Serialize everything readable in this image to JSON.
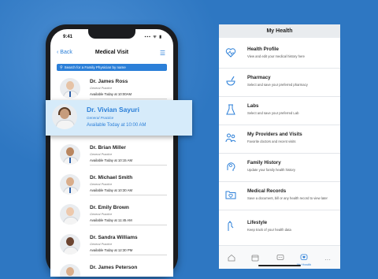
{
  "phone": {
    "status_time": "9:41",
    "status_icons": "▪▪▪ ᯤ ▮",
    "nav": {
      "back_label": "Back",
      "title": "Medical Visit"
    },
    "search_placeholder": "Search for a Family Physician by name",
    "doctors": [
      {
        "name": "Dr. James Ross",
        "specialty": "General Practice",
        "availability": "Available Today at 10:00AM",
        "skin": "#e6c3a6"
      },
      {
        "name": "Dr. Brian Miller",
        "specialty": "General Practice",
        "availability": "Available Today at 10:15 AM",
        "skin": "#b9865f"
      },
      {
        "name": "Dr. Michael Smith",
        "specialty": "General Practice",
        "availability": "Available Today at 10:30 AM",
        "skin": "#d9ad8a"
      },
      {
        "name": "Dr. Emily Brown",
        "specialty": "General Practice",
        "availability": "Available Today at 11:45 AM",
        "skin": "#edc9ad"
      },
      {
        "name": "Dr. Sandra Williams",
        "specialty": "General Practice",
        "availability": "Available Today at 12:30 PM",
        "skin": "#6b4430"
      },
      {
        "name": "Dr. James Peterson",
        "specialty": "",
        "availability": "",
        "skin": "#d9ad8a"
      }
    ],
    "highlighted": {
      "name": "Dr. Vivian Sayuri",
      "specialty": "General Practice",
      "availability": "Available Today at 10:00 AM"
    }
  },
  "panel": {
    "title": "My Health",
    "items": [
      {
        "title": "Health Profile",
        "desc": "View and edit your medical history here",
        "icon": "heart-pulse-icon"
      },
      {
        "title": "Pharmacy",
        "desc": "Select and save your preferred pharmacy",
        "icon": "mortar-pestle-icon"
      },
      {
        "title": "Labs",
        "desc": "Select and save your preferred Lab",
        "icon": "flask-icon"
      },
      {
        "title": "My Providers and Visits",
        "desc": "Favorite doctors and recent visits",
        "icon": "people-icon"
      },
      {
        "title": "Family History",
        "desc": "Update your family health history",
        "icon": "family-head-icon"
      },
      {
        "title": "Medical Records",
        "desc": "Save a document, bill or any health record to view later",
        "icon": "folder-heart-icon"
      },
      {
        "title": "Lifestyle",
        "desc": "Keep track of your health data",
        "icon": "lifestyle-icon"
      }
    ],
    "tabs": [
      {
        "label": "",
        "icon": "home-icon"
      },
      {
        "label": "",
        "icon": "calendar-icon"
      },
      {
        "label": "",
        "icon": "chat-icon"
      },
      {
        "label": "My Health",
        "icon": "heart-chat-icon"
      },
      {
        "label": "",
        "icon": "more-icon"
      }
    ]
  },
  "colors": {
    "background": "#2e77c2",
    "accent": "#2b7fd8",
    "highlight_bg": "#d6ebfa"
  }
}
